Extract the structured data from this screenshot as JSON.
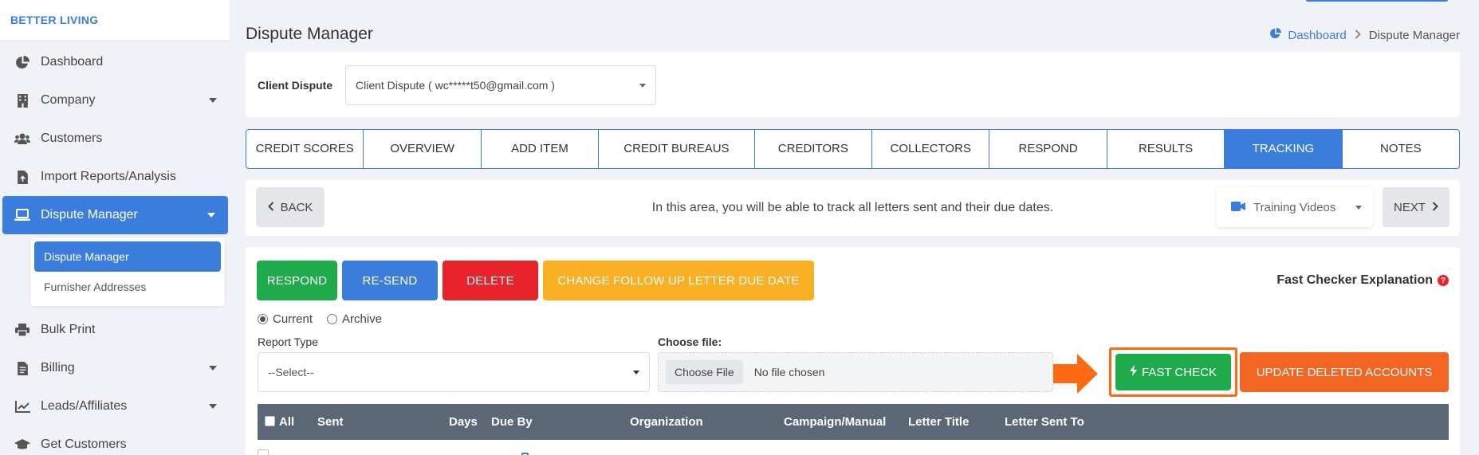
{
  "brand": "BETTER LIVING",
  "sidebar": {
    "items": [
      {
        "label": "Dashboard",
        "icon": "pie-chart-icon"
      },
      {
        "label": "Company",
        "icon": "building-icon",
        "caret": true
      },
      {
        "label": "Customers",
        "icon": "users-icon"
      },
      {
        "label": "Import Reports/Analysis",
        "icon": "file-import-icon"
      },
      {
        "label": "Dispute Manager",
        "icon": "laptop-icon",
        "caret": true,
        "active": true
      },
      {
        "label": "Bulk Print",
        "icon": "print-icon"
      },
      {
        "label": "Billing",
        "icon": "invoice-icon",
        "caret": true
      },
      {
        "label": "Leads/Affiliates",
        "icon": "chart-line-icon",
        "caret": true
      },
      {
        "label": "Get Customers",
        "icon": "graduation-cap-icon"
      }
    ],
    "submenu": [
      {
        "label": "Dispute Manager",
        "active": true
      },
      {
        "label": "Furnisher Addresses"
      }
    ]
  },
  "header": {
    "title": "Dispute Manager",
    "breadcrumb": {
      "home": "Dashboard",
      "current": "Dispute Manager"
    }
  },
  "client": {
    "label": "Client Dispute",
    "selected": "Client Dispute ( wc*****t50@gmail.com )"
  },
  "tabs": [
    {
      "label": "CREDIT SCORES"
    },
    {
      "label": "OVERVIEW"
    },
    {
      "label": "ADD ITEM"
    },
    {
      "label": "CREDIT BUREAUS"
    },
    {
      "label": "CREDITORS"
    },
    {
      "label": "COLLECTORS"
    },
    {
      "label": "RESPOND"
    },
    {
      "label": "RESULTS"
    },
    {
      "label": "TRACKING",
      "active": true
    },
    {
      "label": "NOTES"
    }
  ],
  "info": {
    "back": "BACK",
    "text": "In this area, you will be able to track all letters sent and their due dates.",
    "training": "Training Videos",
    "next": "NEXT"
  },
  "actions": {
    "respond": "RESPOND",
    "resend": "RE-SEND",
    "delete": "DELETE",
    "change_due": "CHANGE FOLLOW UP LETTER DUE DATE",
    "fast_checker_explanation": "Fast Checker Explanation",
    "fast_check": "FAST CHECK",
    "update_deleted": "UPDATE DELETED ACCOUNTS"
  },
  "filters": {
    "current": "Current",
    "archive": "Archive",
    "report_type_label": "Report Type",
    "report_type_value": "--Select--",
    "choose_file_label": "Choose file:",
    "choose_file_button": "Choose File",
    "no_file": "No file chosen"
  },
  "table": {
    "columns": [
      "All",
      "Sent",
      "Days",
      "Due By",
      "Organization",
      "Campaign/Manual",
      "Letter Title",
      "Letter Sent To"
    ]
  },
  "colors": {
    "primary": "#3b7ddd",
    "success": "#1faa4b",
    "danger": "#e8232c",
    "warning": "#fbb023",
    "orange": "#f26522",
    "highlight": "#ff6a10",
    "table_header": "#5b6677"
  }
}
